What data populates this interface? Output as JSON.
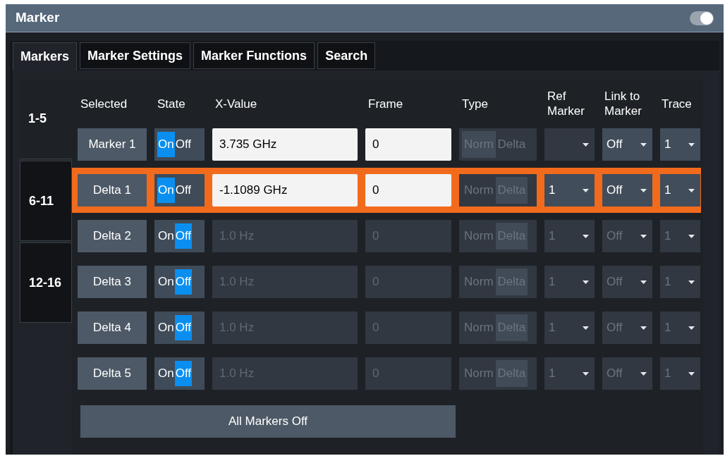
{
  "window": {
    "title": "Marker",
    "toggle_on": true
  },
  "tabs": [
    {
      "label": "Markers",
      "selected": true
    },
    {
      "label": "Marker Settings",
      "selected": false
    },
    {
      "label": "Marker Functions",
      "selected": false
    },
    {
      "label": "Search",
      "selected": false
    }
  ],
  "ranges": [
    {
      "label": "1-5",
      "selected": true
    },
    {
      "label": "6-11",
      "selected": false
    },
    {
      "label": "12-16",
      "selected": false
    }
  ],
  "columns": [
    "Selected",
    "State",
    "X-Value",
    "Frame",
    "Type",
    "Ref Marker",
    "Link to Marker",
    "Trace"
  ],
  "rows": [
    {
      "label": "Marker 1",
      "state": [
        {
          "label": "On",
          "selected": true
        },
        {
          "label": "Off",
          "selected": false
        }
      ],
      "x_value": "3.735 GHz",
      "frame": "0",
      "type": [
        {
          "label": "Norm",
          "selected": true
        },
        {
          "label": "Delta",
          "selected": false
        }
      ],
      "link": "Off",
      "trace": "1",
      "selected": false
    },
    {
      "label": "Delta 1",
      "state": [
        {
          "label": "On",
          "selected": true
        },
        {
          "label": "Off",
          "selected": false
        }
      ],
      "x_value": "-1.1089 GHz",
      "frame": "0",
      "type": [
        {
          "label": "Norm",
          "selected": false
        },
        {
          "label": "Delta",
          "selected": true
        }
      ],
      "ref_marker": "1",
      "link": "Off",
      "trace": "1",
      "selected": true
    },
    {
      "label": "Delta 2",
      "state": [
        {
          "label": "On",
          "selected": false
        },
        {
          "label": "Off",
          "selected": true
        }
      ],
      "x_value": "1.0 Hz",
      "frame": "0",
      "type": [
        {
          "label": "Norm",
          "selected": false
        },
        {
          "label": "Delta",
          "selected": true
        }
      ],
      "ref_marker": "1",
      "link": "Off",
      "trace": "1",
      "selected": false
    },
    {
      "label": "Delta 3",
      "state": [
        {
          "label": "On",
          "selected": false
        },
        {
          "label": "Off",
          "selected": true
        }
      ],
      "x_value": "1.0 Hz",
      "frame": "0",
      "type": [
        {
          "label": "Norm",
          "selected": false
        },
        {
          "label": "Delta",
          "selected": true
        }
      ],
      "ref_marker": "1",
      "link": "Off",
      "trace": "1",
      "selected": false
    },
    {
      "label": "Delta 4",
      "state": [
        {
          "label": "On",
          "selected": false
        },
        {
          "label": "Off",
          "selected": true
        }
      ],
      "x_value": "1.0 Hz",
      "frame": "0",
      "type": [
        {
          "label": "Norm",
          "selected": false
        },
        {
          "label": "Delta",
          "selected": true
        }
      ],
      "ref_marker": "1",
      "link": "Off",
      "trace": "1",
      "selected": false
    },
    {
      "label": "Delta 5",
      "state": [
        {
          "label": "On",
          "selected": false
        },
        {
          "label": "Off",
          "selected": true
        }
      ],
      "x_value": "1.0 Hz",
      "frame": "0",
      "type": [
        {
          "label": "Norm",
          "selected": false
        },
        {
          "label": "Delta",
          "selected": true
        }
      ],
      "ref_marker": "1",
      "link": "Off",
      "trace": "1",
      "selected": false
    }
  ],
  "all_off_button": "All Markers Off"
}
